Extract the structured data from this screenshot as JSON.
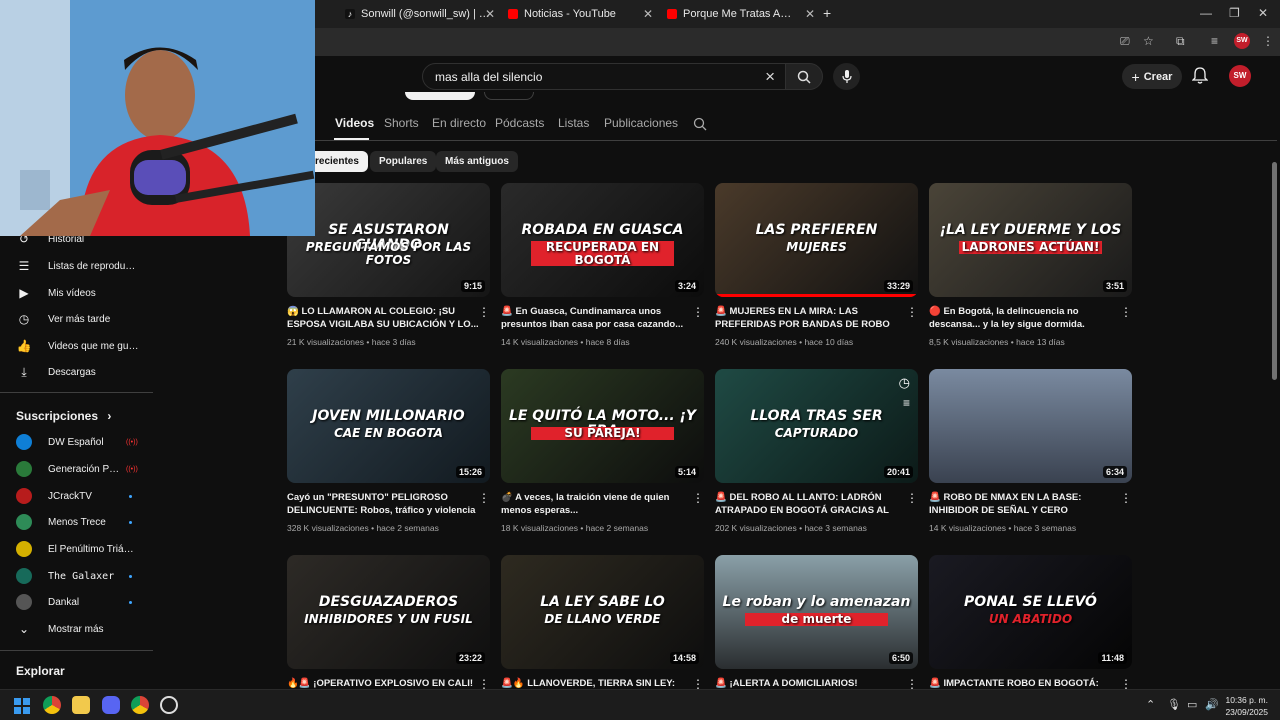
{
  "browser": {
    "tabs": [
      {
        "title": "Sonwill (@sonwill_sw) | TikTok",
        "icon": "tiktok-icon"
      },
      {
        "title": "Noticias - YouTube",
        "icon": "youtube-icon"
      },
      {
        "title": "Porque Me Tratas Así - YouTube",
        "icon": "youtube-icon"
      }
    ],
    "profile_initials": "SW"
  },
  "header": {
    "search_value": "mas alla del silencio",
    "create_label": "Crear",
    "avatar_initials": "SW"
  },
  "channel_tabs": [
    "Videos",
    "Shorts",
    "En directo",
    "Pódcasts",
    "Listas",
    "Publicaciones"
  ],
  "chips": [
    "recientes",
    "Populares",
    "Más antiguos"
  ],
  "sidebar": {
    "items": [
      {
        "label": "Historial",
        "icon": "history-icon"
      },
      {
        "label": "Listas de reproducción",
        "icon": "playlist-icon"
      },
      {
        "label": "Mis vídeos",
        "icon": "my-videos-icon"
      },
      {
        "label": "Ver más tarde",
        "icon": "watch-later-icon"
      },
      {
        "label": "Videos que me gustan",
        "icon": "thumbs-up-icon"
      },
      {
        "label": "Descargas",
        "icon": "download-icon"
      }
    ],
    "subscriptions_title": "Suscripciones",
    "subscriptions": [
      {
        "label": "DW Español",
        "color": "#0f7fd6",
        "badge": "live"
      },
      {
        "label": "Generación Pentagono",
        "color": "#2a7a3a",
        "badge": "live"
      },
      {
        "label": "JCrackTV",
        "color": "#b71c1c",
        "badge": "dot"
      },
      {
        "label": "Menos Trece",
        "color": "#2e8b57",
        "badge": "dot"
      },
      {
        "label": "El Penúltimo Triángulo",
        "color": "#d4b000",
        "badge": ""
      },
      {
        "label": "The Galaxer",
        "color": "#176a5a",
        "badge": "dot"
      },
      {
        "label": "Dankal",
        "color": "#555555",
        "badge": "dot"
      }
    ],
    "show_more": "Mostrar más",
    "explore_title": "Explorar"
  },
  "videos": [
    {
      "title": "😱 LO LLAMARON AL COLEGIO: ¡SU ESPOSA VIGILABA SU UBICACIÓN Y LO...",
      "meta": "21 K visualizaciones • hace 3 días",
      "duration": "9:15",
      "caption": "SE ASUSTARON CUANDO",
      "caption2": "PREGUNTAMOS POR LAS FOTOS"
    },
    {
      "title": "🚨 En Guasca, Cundinamarca unos presuntos iban casa por casa cazando...",
      "meta": "14 K visualizaciones • hace 8 días",
      "duration": "3:24",
      "caption": "ROBADA EN GUASCA",
      "caption2": "RECUPERADA EN BOGOTÁ"
    },
    {
      "title": "🚨 MUJERES EN LA MIRA: LAS PREFERIDAS POR BANDAS DE ROBO DE...",
      "meta": "240 K visualizaciones • hace 10 días",
      "duration": "33:29",
      "caption": "LAS PREFIEREN",
      "caption2": "MUJERES"
    },
    {
      "title": "🔴 En Bogotá, la delincuencia no descansa... y la ley sigue dormida.",
      "meta": "8,5 K visualizaciones • hace 13 días",
      "duration": "3:51",
      "caption": "¡LA LEY DUERME Y LOS",
      "caption2": "LADRONES ACTÚAN!"
    },
    {
      "title": "Cayó un \"PRESUNTO\" PELIGROSO DELINCUENTE: Robos, tráfico y violencia e...",
      "meta": "328 K visualizaciones • hace 2 semanas",
      "duration": "15:26",
      "caption": "JOVEN MILLONARIO",
      "caption2": "CAE EN BOGOTA"
    },
    {
      "title": "💣 A veces, la traición viene de quien menos esperas...",
      "meta": "18 K visualizaciones • hace 2 semanas",
      "duration": "5:14",
      "caption": "LE QUITÓ LA MOTO... ¡Y ERA",
      "caption2": "SU PAREJA!"
    },
    {
      "title": "🚨 DEL ROBO AL LLANTO: LADRÓN ATRAPADO EN BOGOTÁ GRACIAS AL GPS...",
      "meta": "202 K visualizaciones • hace 3 semanas",
      "duration": "20:41",
      "caption": "LLORA TRAS SER",
      "caption2": "CAPTURADO"
    },
    {
      "title": "🚨 ROBO DE NMAX EN LA BASE: INHIBIDOR DE SEÑAL Y CERO AUTORIDAD 🏍️ ❌",
      "meta": "14 K visualizaciones • hace 3 semanas",
      "duration": "6:34",
      "caption": "",
      "caption2": ""
    },
    {
      "title": "🔥🚨 ¡OPERATIVO EXPLOSIVO EN CALI! 🚓",
      "meta": "",
      "duration": "23:22",
      "caption": "DESGUAZADEROS",
      "caption2": "INHIBIDORES Y UN FUSIL"
    },
    {
      "title": "🚨🔥 LLANOVERDE, TIERRA SIN LEY:",
      "meta": "",
      "duration": "14:58",
      "caption": "LA LEY SABE LO",
      "caption2": "DE LLANO VERDE"
    },
    {
      "title": "🚨 ¡ALERTA A DOMICILIARIOS!",
      "meta": "",
      "duration": "6:50",
      "caption": "Le roban y lo amenazan",
      "caption2": "de muerte"
    },
    {
      "title": "🚨 IMPACTANTE ROBO EN BOGOTÁ: SPARK",
      "meta": "",
      "duration": "11:48",
      "caption": "PONAL SE LLEVÓ",
      "caption2": "UN ABATIDO"
    }
  ],
  "taskbar": {
    "time": "10:36 p. m.",
    "date": "23/09/2025"
  }
}
